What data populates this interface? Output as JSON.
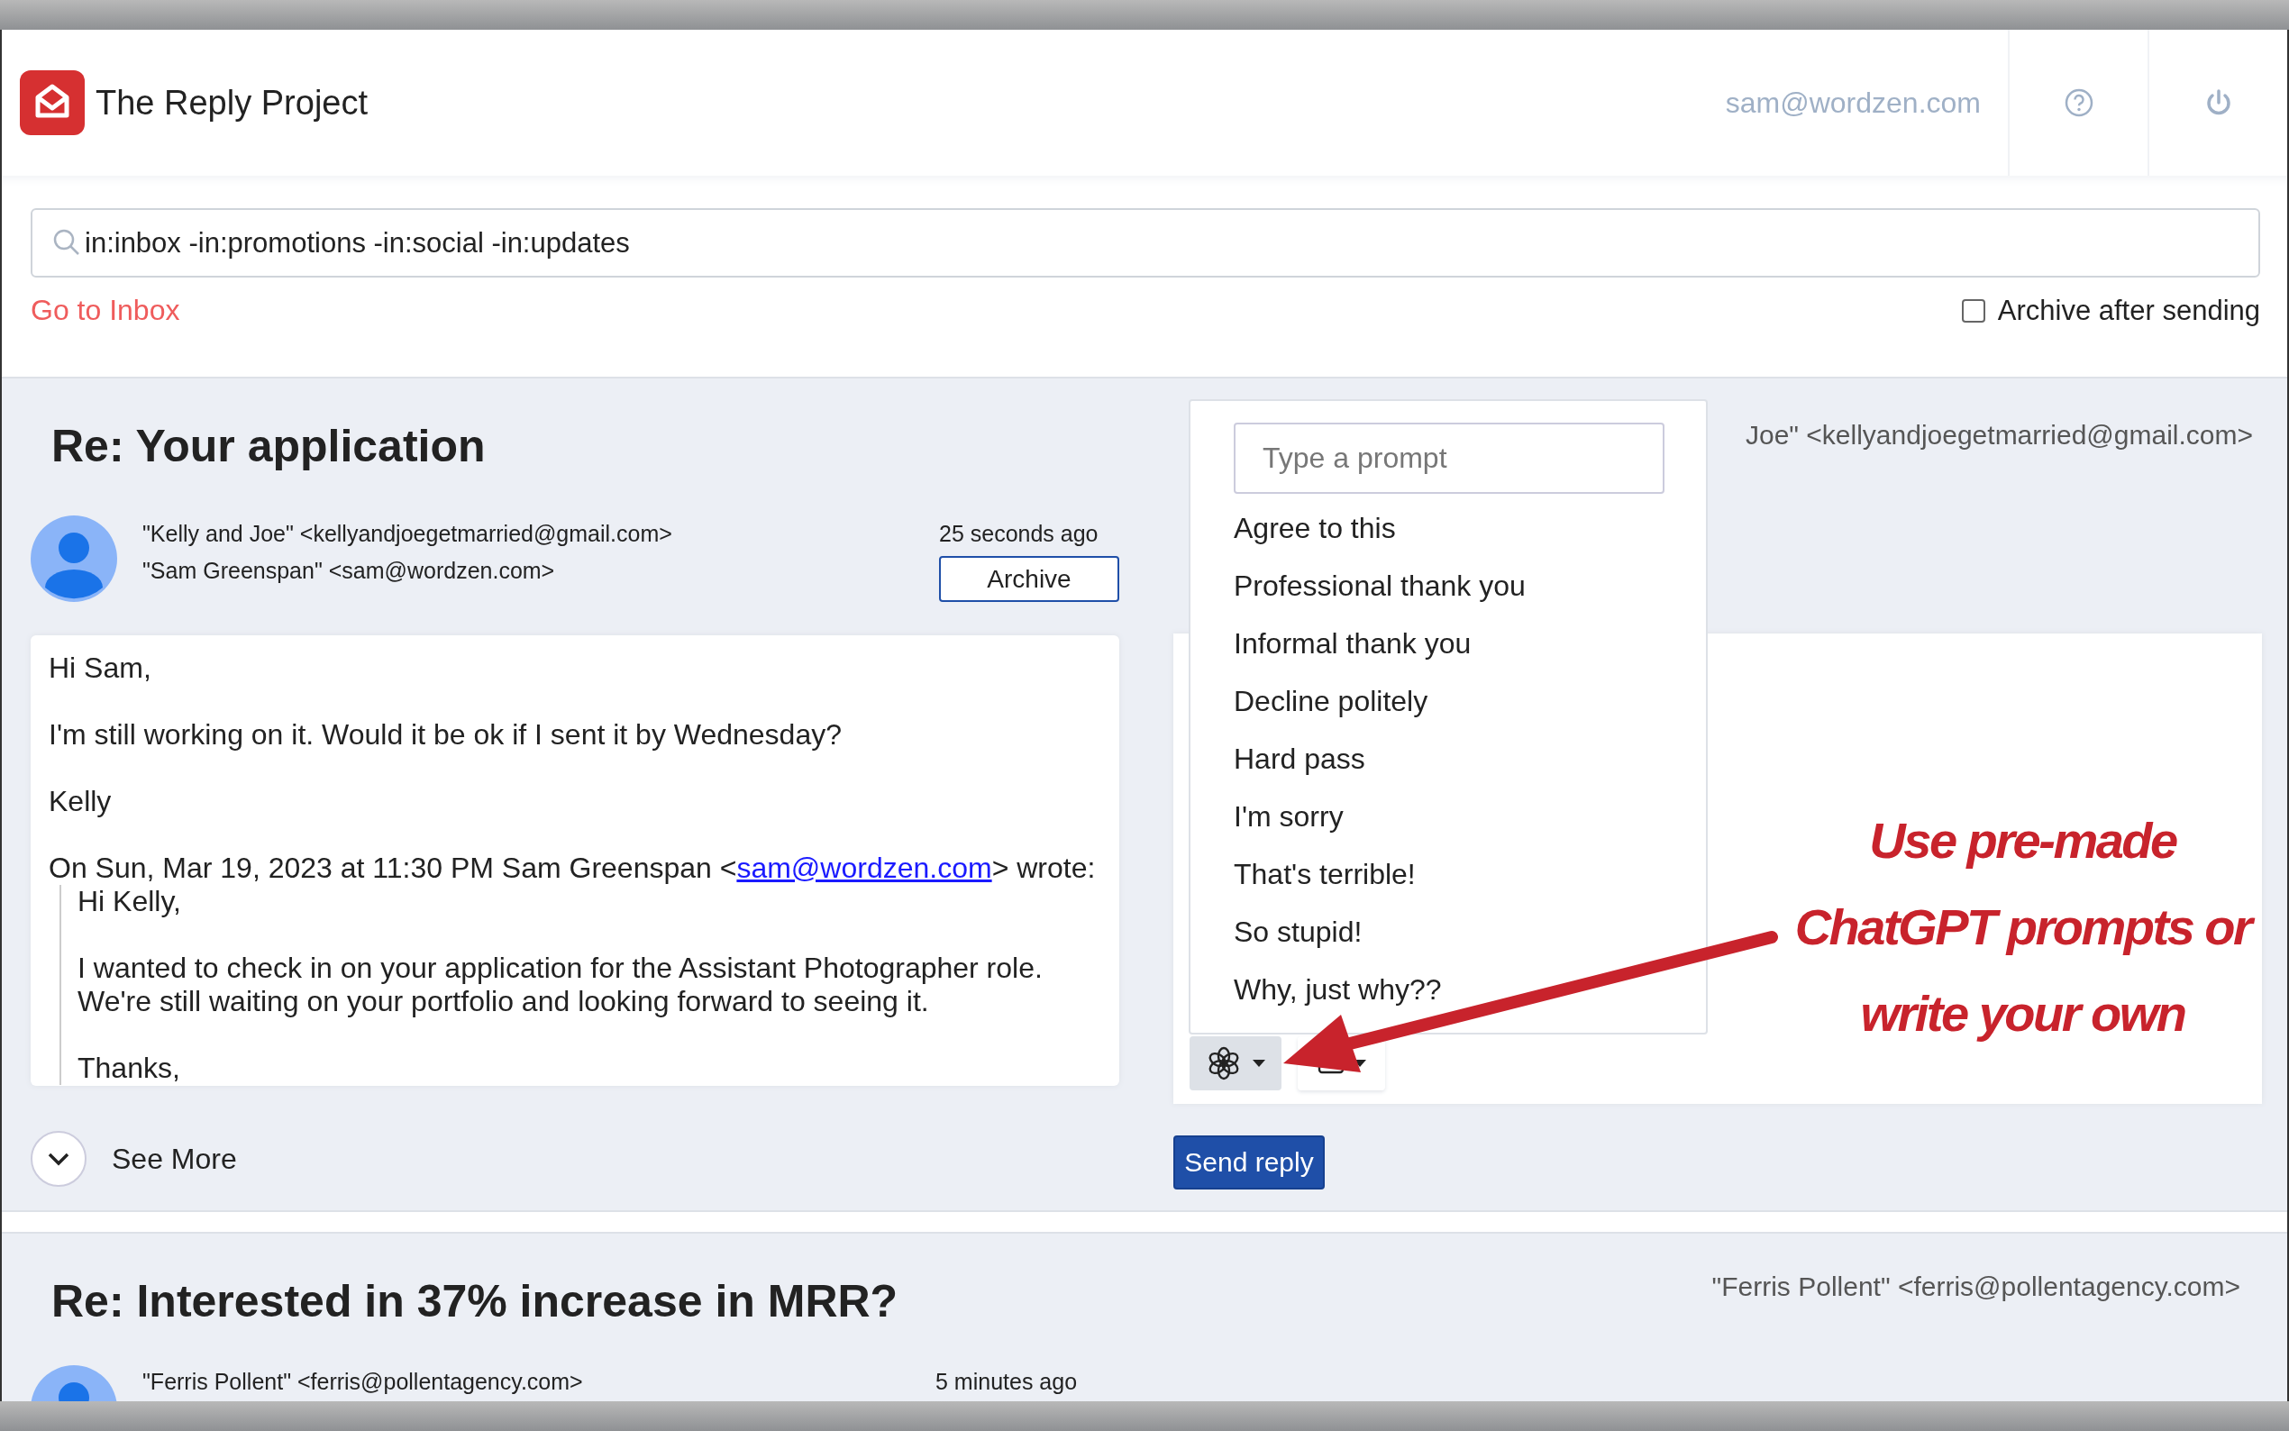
{
  "app": {
    "title": "The Reply Project",
    "account": "sam@wordzen.com"
  },
  "search": {
    "value": "in:inbox -in:promotions -in:social -in:updates"
  },
  "go_to_inbox": "Go to Inbox",
  "archive_after_sending": {
    "label": "Archive after sending",
    "checked": false
  },
  "open_thread": {
    "subject": "Re: Your application",
    "from": "\"Kelly and Joe\" <kellyandjoegetmarried@gmail.com>",
    "to": "\"Sam Greenspan\" <sam@wordzen.com>",
    "time": "25 seconds ago",
    "archive": "Archive",
    "body": [
      "Hi Sam,",
      "I'm still working on it. Would it be ok if I sent it by Wednesday?",
      "Kelly"
    ],
    "quote_header": {
      "before": "On Sun, Mar 19, 2023 at 11:30 PM Sam Greenspan <",
      "link": "sam@wordzen.com",
      "after": "> wrote:"
    },
    "quote": [
      [
        "Hi Kelly,"
      ],
      [
        "I wanted to check in on your application for the Assistant Photographer role.",
        "We're still waiting on your portfolio and looking forward to seeing it."
      ],
      [
        "Thanks,"
      ]
    ],
    "see_more": "See More",
    "reply": {
      "recipient": "Joe\" <kellyandjoegetmarried@gmail.com>",
      "send": "Send reply"
    }
  },
  "prompt_menu": {
    "placeholder": "Type a prompt",
    "items": [
      "Agree to this",
      "Professional thank you",
      "Informal thank you",
      "Decline politely",
      "Hard pass",
      "I'm sorry",
      "That's terrible!",
      "So stupid!",
      "Why, just why??"
    ]
  },
  "annotation": [
    "Use pre-made",
    "ChatGPT prompts or",
    "write your own"
  ],
  "next_thread": {
    "subject": "Re: Interested in 37% increase in MRR?",
    "header_from": "\"Ferris Pollent\" <ferris@pollentagency.com>",
    "from": "\"Ferris Pollent\" <ferris@pollentagency.com>",
    "time": "5 minutes ago"
  }
}
